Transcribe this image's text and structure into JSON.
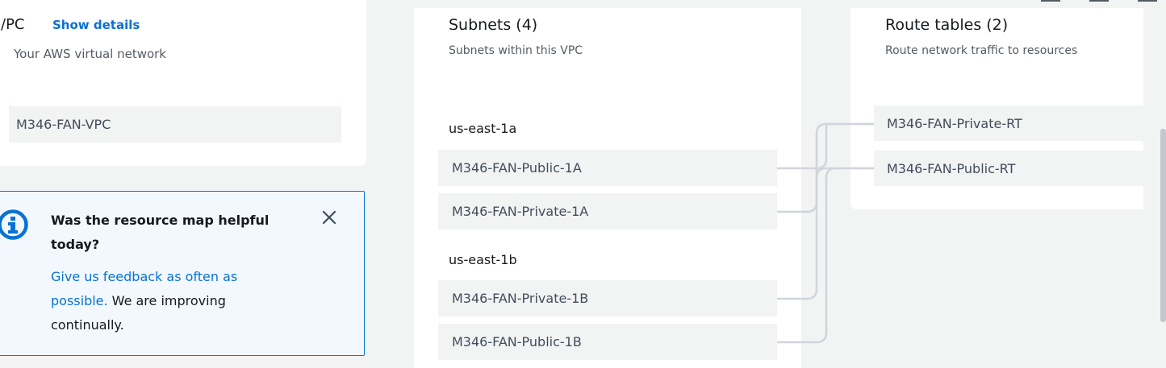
{
  "vpc": {
    "title_fragment": "/PC",
    "show_details": "Show details",
    "description": "Your AWS virtual network",
    "resource": "M346-FAN-VPC"
  },
  "subnets": {
    "title": "Subnets (4)",
    "description": "Subnets within this VPC",
    "zones": [
      {
        "name": "us-east-1a",
        "items": [
          "M346-FAN-Public-1A",
          "M346-FAN-Private-1A"
        ]
      },
      {
        "name": "us-east-1b",
        "items": [
          "M346-FAN-Private-1B",
          "M346-FAN-Public-1B"
        ]
      }
    ]
  },
  "route_tables": {
    "title": "Route tables (2)",
    "description": "Route network traffic to resources",
    "items": [
      "M346-FAN-Private-RT",
      "M346-FAN-Public-RT"
    ]
  },
  "feedback": {
    "title": "Was the resource map helpful today?",
    "link_text": "Give us feedback as often as possible.",
    "body_text": " We are improving continually.",
    "icon": "info-icon",
    "close_icon": "close-icon"
  },
  "colors": {
    "link": "#0972d3",
    "panel": "#ffffff",
    "background": "#f2f3f3",
    "connector": "#d1d5db"
  }
}
